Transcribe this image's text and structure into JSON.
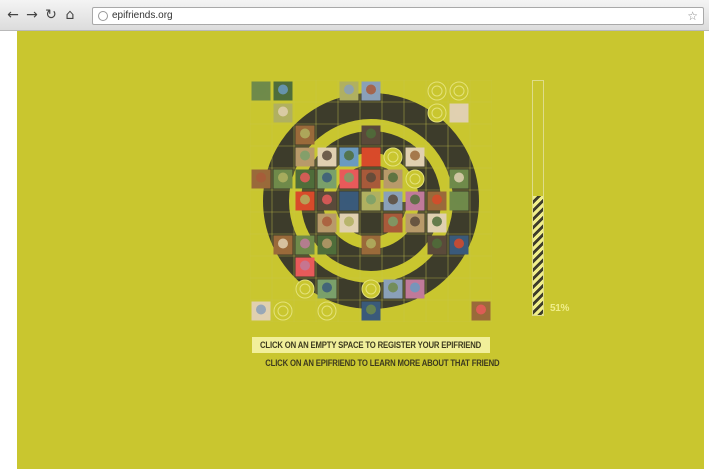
{
  "browser": {
    "url": "epifriends.org",
    "icons": {
      "back": "back-arrow-icon",
      "forward": "forward-arrow-icon",
      "reload": "reload-icon",
      "home": "home-icon",
      "page": "globe-icon",
      "bookmark": "star-icon"
    }
  },
  "page": {
    "progress_label": "51%",
    "progress_fraction": 0.51,
    "cta_text": "CLICK ON AN EMPTY SPACE TO REGISTER YOUR EPIFRIEND",
    "hint_text": "CLICK ON AN EPIFRIEND TO LEARN MORE ABOUT THAT FRIEND",
    "colors": {
      "background": "#c9c62f",
      "dark": "#3d3c2b",
      "highlight": "#f1ef9a"
    }
  }
}
